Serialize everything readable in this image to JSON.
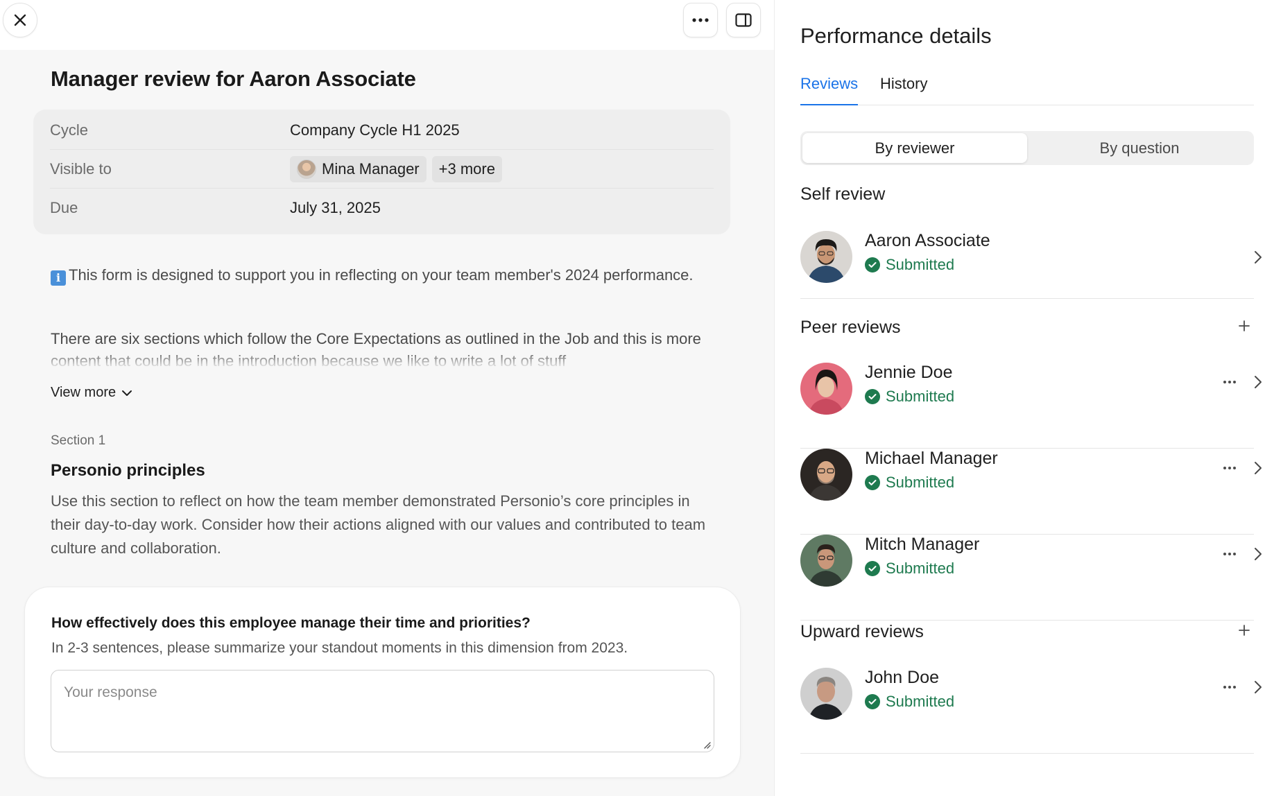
{
  "left": {
    "title": "Manager review for Aaron Associate",
    "info": {
      "cycle_label": "Cycle",
      "cycle_value": "Company Cycle H1 2025",
      "visible_label": "Visible to",
      "visible_person": "Mina Manager",
      "visible_more": "+3 more",
      "due_label": "Due",
      "due_value": "July 31, 2025"
    },
    "description_1": "This form is designed to support you in reflecting on your team member's 2024 performance.",
    "description_2": "There are six sections which follow the Core Expectations as outlined in the Job  and this is more content that could be in the introduction because we like to write a lot of stuff",
    "view_more": "View more",
    "section_kicker": "Section 1",
    "section_title": "Personio principles",
    "section_body": "Use this section to reflect on how the team member demonstrated Personio’s core principles in their day-to-day work. Consider how their actions aligned with our values and contributed to team culture and collaboration.",
    "question": {
      "title": "How effectively does this employee manage their time and priorities?",
      "subtitle": "In 2-3 sentences, please summarize your standout moments in this dimension from 2023.",
      "placeholder": "Your response"
    }
  },
  "right": {
    "title": "Performance details",
    "tabs": [
      "Reviews",
      "History"
    ],
    "segments": [
      "By reviewer",
      "By question"
    ],
    "self_review_title": "Self review",
    "peer_reviews_title": "Peer reviews",
    "upward_reviews_title": "Upward reviews",
    "status_text": "Submitted",
    "self": [
      {
        "name": "Aaron Associate",
        "status": "Submitted"
      }
    ],
    "peers": [
      {
        "name": "Jennie Doe",
        "status": "Submitted"
      },
      {
        "name": "Michael Manager",
        "status": "Submitted"
      },
      {
        "name": "Mitch Manager",
        "status": "Submitted"
      }
    ],
    "upward": [
      {
        "name": "John Doe",
        "status": "Submitted"
      }
    ]
  },
  "colors": {
    "accent": "#1a73e8",
    "success": "#1e7a4f",
    "left_background": "#f7f7f7"
  },
  "icons": {
    "close": "close-icon",
    "more": "more-horizontal-icon",
    "panel": "panel-toggle-icon",
    "info": "info-icon",
    "chevron_down": "chevron-down-icon",
    "chevron_right": "chevron-right-icon",
    "check": "check-circle-icon",
    "plus": "plus-icon"
  }
}
